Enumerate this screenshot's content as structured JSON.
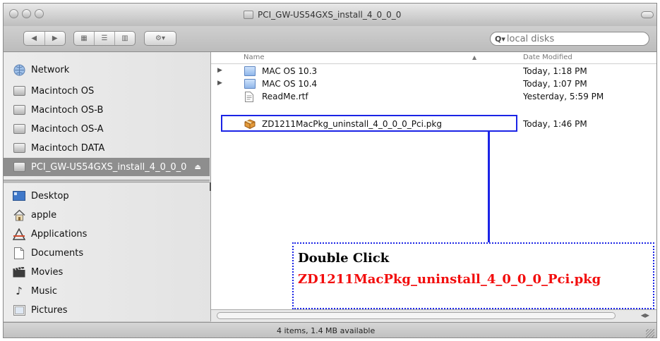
{
  "window": {
    "title": "PCI_GW-US54GXS_install_4_0_0_0"
  },
  "toolbar": {
    "back_label": "◀",
    "forward_label": "▶",
    "view_icon_label": "▦",
    "view_list_label": "☰",
    "view_column_label": "▥",
    "action_label": "⚙▾",
    "search_placeholder": "local disks"
  },
  "sidebar": {
    "devices": [
      {
        "label": "Network",
        "icon": "network-icon"
      },
      {
        "label": "Macintoch OS",
        "icon": "disk-icon"
      },
      {
        "label": "Macintoch OS-B",
        "icon": "disk-icon"
      },
      {
        "label": "Macintoch OS-A",
        "icon": "disk-icon"
      },
      {
        "label": "Macintoch DATA",
        "icon": "disk-icon"
      },
      {
        "label": "PCI_GW-US54GXS_install_4_0_0_0",
        "icon": "disk-image-icon",
        "selected": true
      }
    ],
    "places": [
      {
        "label": "Desktop",
        "icon": "desktop-icon"
      },
      {
        "label": "apple",
        "icon": "home-icon"
      },
      {
        "label": "Applications",
        "icon": "applications-icon"
      },
      {
        "label": "Documents",
        "icon": "documents-icon"
      },
      {
        "label": "Movies",
        "icon": "movies-icon"
      },
      {
        "label": "Music",
        "icon": "music-icon"
      },
      {
        "label": "Pictures",
        "icon": "pictures-icon"
      }
    ]
  },
  "list": {
    "columns": {
      "name": "Name",
      "date": "Date Modified"
    },
    "rows": [
      {
        "name": "MAC OS 10.3",
        "date": "Today, 1:18 PM",
        "type": "folder"
      },
      {
        "name": "MAC OS 10.4",
        "date": "Today, 1:07 PM",
        "type": "folder"
      },
      {
        "name": "ReadMe.rtf",
        "date": "Yesterday, 5:59 PM",
        "type": "document"
      },
      {
        "name": "ZD1211MacPkg_uninstall_4_0_0_0_Pci.pkg",
        "date": "Today, 1:46 PM",
        "type": "package"
      }
    ]
  },
  "callout": {
    "line1": "Double Click",
    "line2": "ZD1211MacPkg_uninstall_4_0_0_0_Pci.pkg"
  },
  "status": {
    "text": "4 items, 1.4 MB available"
  },
  "colors": {
    "highlight": "#1b24e6",
    "callout_text_red": "#f20d0d",
    "selected_sidebar": "#8e8e8e"
  }
}
